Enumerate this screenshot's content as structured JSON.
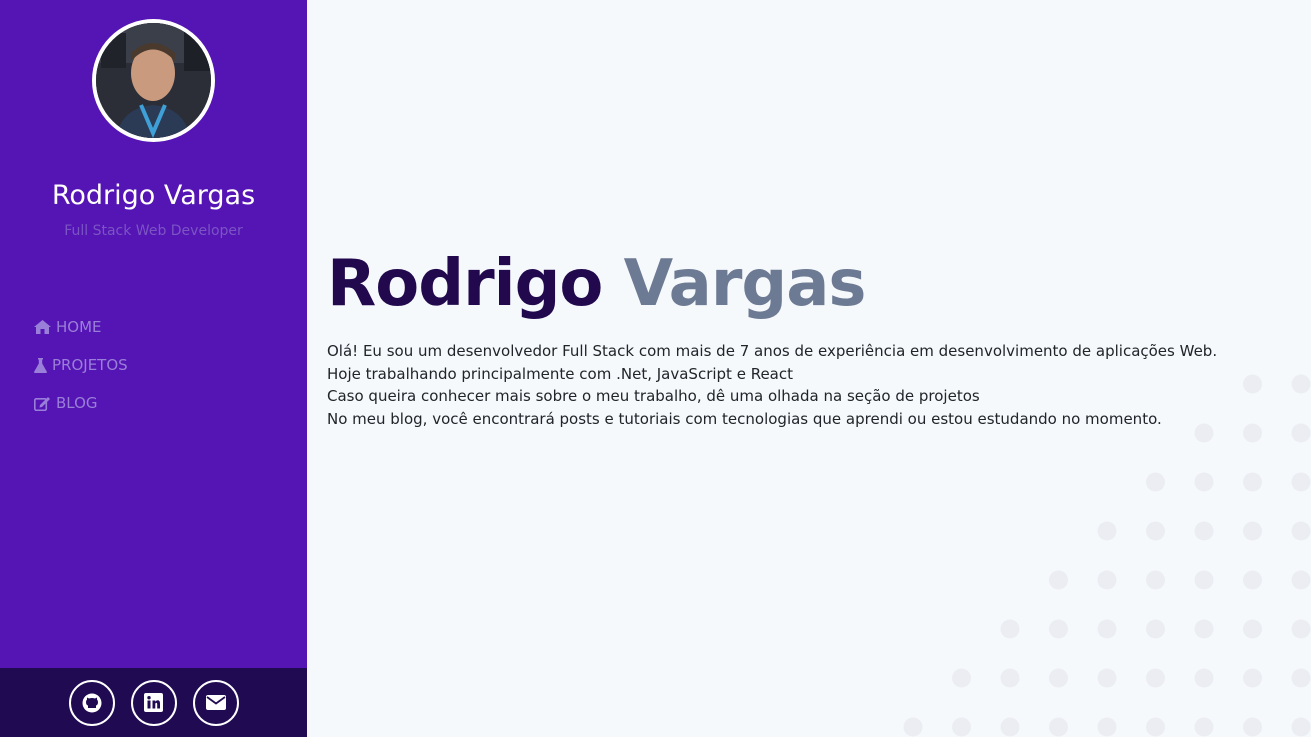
{
  "profile": {
    "name": "Rodrigo Vargas",
    "role": "Full Stack Web Developer"
  },
  "nav": {
    "items": [
      {
        "label": "HOME",
        "icon": "home-icon"
      },
      {
        "label": "PROJETOS",
        "icon": "flask-icon"
      },
      {
        "label": "BLOG",
        "icon": "edit-icon"
      }
    ]
  },
  "social": [
    {
      "icon": "github-icon"
    },
    {
      "icon": "linkedin-icon"
    },
    {
      "icon": "envelope-icon"
    }
  ],
  "hero": {
    "first_name": "Rodrigo",
    "last_name": "Vargas",
    "lines": [
      "Olá! Eu sou um desenvolvedor Full Stack com mais de 7 anos de experiência em desenvolvimento de aplicações Web. Hoje trabalhando principalmente com .Net, JavaScript e React",
      "Caso queira conhecer mais sobre o meu trabalho, dê uma olhada na seção de projetos",
      "No meu blog, você encontrará posts e tutoriais com tecnologias que aprendi ou estou estudando no momento."
    ]
  },
  "colors": {
    "sidebar": "#5514b4",
    "sidebar_footer": "#200a52",
    "title_dark": "#22094d",
    "title_gray": "#6d7a93",
    "background": "#f6f9fc"
  }
}
